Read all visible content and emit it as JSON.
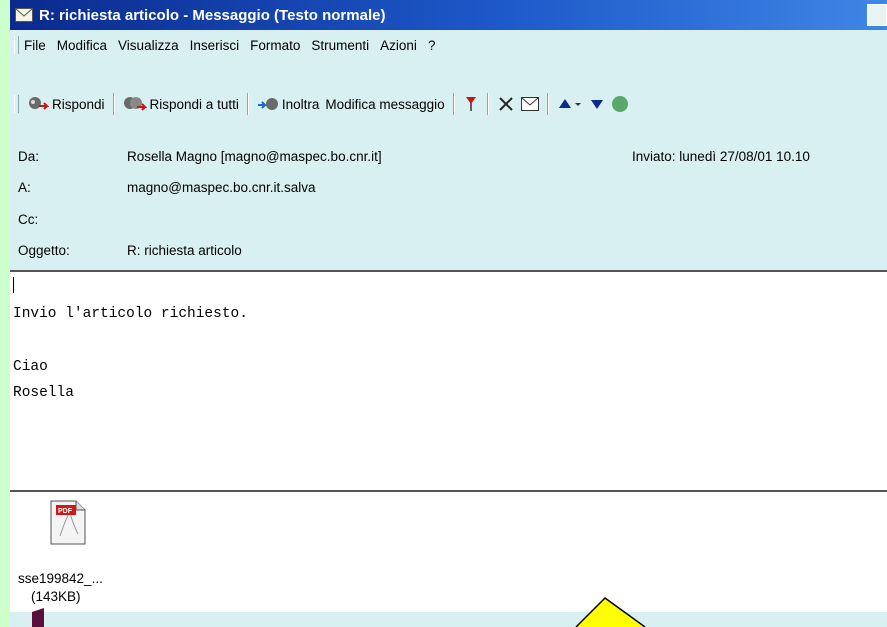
{
  "window": {
    "title": "R: richiesta articolo - Messaggio (Testo normale)"
  },
  "menu": [
    "File",
    "Modifica",
    "Visualizza",
    "Inserisci",
    "Formato",
    "Strumenti",
    "Azioni",
    "?"
  ],
  "toolbar": {
    "reply": "Rispondi",
    "reply_all": "Rispondi a tutti",
    "forward": "Inoltra",
    "edit_message": "Modifica messaggio"
  },
  "header": {
    "from_label": "Da:",
    "from_value": "Rosella Magno [magno@maspec.bo.cnr.it]",
    "sent_label": "Inviato:",
    "sent_value": "lunedì 27/08/01 10.10",
    "to_label": "A:",
    "to_value": "magno@maspec.bo.cnr.it.salva",
    "cc_label": "Cc:",
    "cc_value": "",
    "subject_label": "Oggetto:",
    "subject_value": "R: richiesta articolo"
  },
  "body": {
    "lines": [
      "Invio l'articolo richiesto.",
      "",
      "Ciao",
      "Rosella"
    ]
  },
  "attachment": {
    "icon": "pdf-icon",
    "icon_text": "PDF",
    "name": "sse199842_...",
    "size": "(143KB)"
  },
  "colors": {
    "titlebar_start": "#0a2a8e",
    "titlebar_end": "#3f86e6",
    "window_bg": "#d8f0f2",
    "slide_bg": "#ccffcc",
    "diamond": "#ffff00",
    "bookmark": "#5a0f3a"
  }
}
